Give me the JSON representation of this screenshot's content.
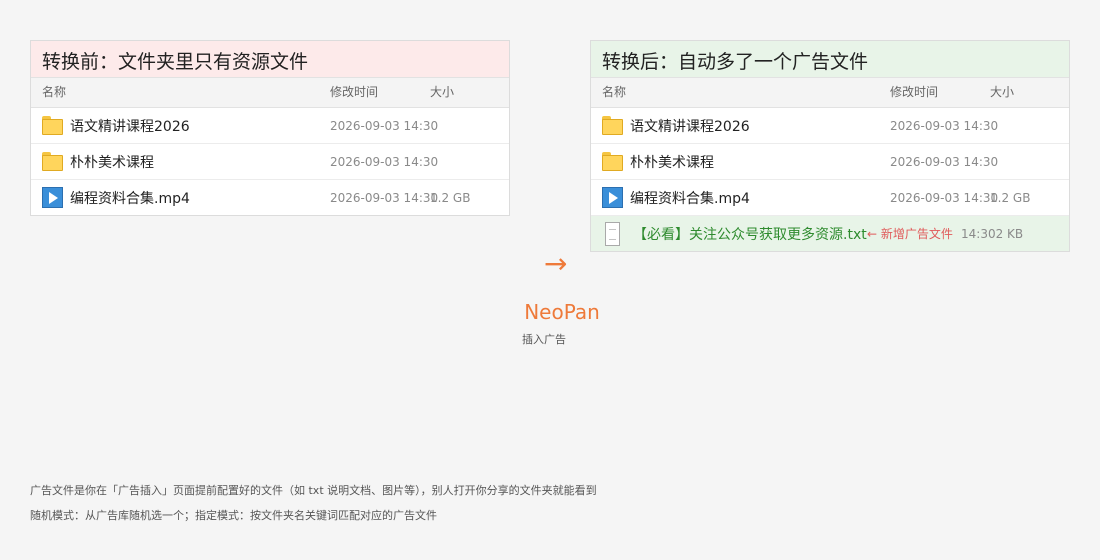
{
  "before": {
    "title": "转换前：文件夹里只有资源文件",
    "columns": {
      "name": "名称",
      "date": "修改时间",
      "size": "大小"
    },
    "rows": [
      {
        "icon": "folder-icon",
        "name": "语文精讲课程2026",
        "date": "2026-09-03 14:30",
        "size": ""
      },
      {
        "icon": "folder-icon",
        "name": "朴朴美术课程",
        "date": "2026-09-03 14:30",
        "size": ""
      },
      {
        "icon": "video-icon",
        "name": "编程资料合集.mp4",
        "date": "2026-09-03 14:30",
        "size": "1.2 GB"
      }
    ]
  },
  "after": {
    "title": "转换后：自动多了一个广告文件",
    "columns": {
      "name": "名称",
      "date": "修改时间",
      "size": "大小"
    },
    "rows": [
      {
        "icon": "folder-icon",
        "name": "语文精讲课程2026",
        "date": "2026-09-03 14:30",
        "size": ""
      },
      {
        "icon": "folder-icon",
        "name": "朴朴美术课程",
        "date": "2026-09-03 14:30",
        "size": ""
      },
      {
        "icon": "video-icon",
        "name": "编程资料合集.mp4",
        "date": "2026-09-03 14:30",
        "size": "1.2 GB"
      }
    ],
    "ad_row": {
      "icon": "txt-file-icon",
      "name": "【必看】关注公众号获取更多资源.txt",
      "note": "← 新增广告文件",
      "date": "14:30",
      "size": "2 KB"
    }
  },
  "arrow": "→",
  "brand": {
    "name": "NeoPan",
    "subtitle": "插入广告"
  },
  "footnotes": {
    "line1": "广告文件是你在「广告插入」页面提前配置好的文件（如 txt 说明文档、图片等），别人打开你分享的文件夹就能看到",
    "line2": "随机模式：从广告库随机选一个；指定模式：按文件夹名关键词匹配对应的广告文件"
  },
  "colors": {
    "accent": "#ee7a3a",
    "before_header": "#fdeaea",
    "after_header": "#e8f4e8",
    "ad_text": "#2e8b2e",
    "note_text": "#e05a5a"
  }
}
